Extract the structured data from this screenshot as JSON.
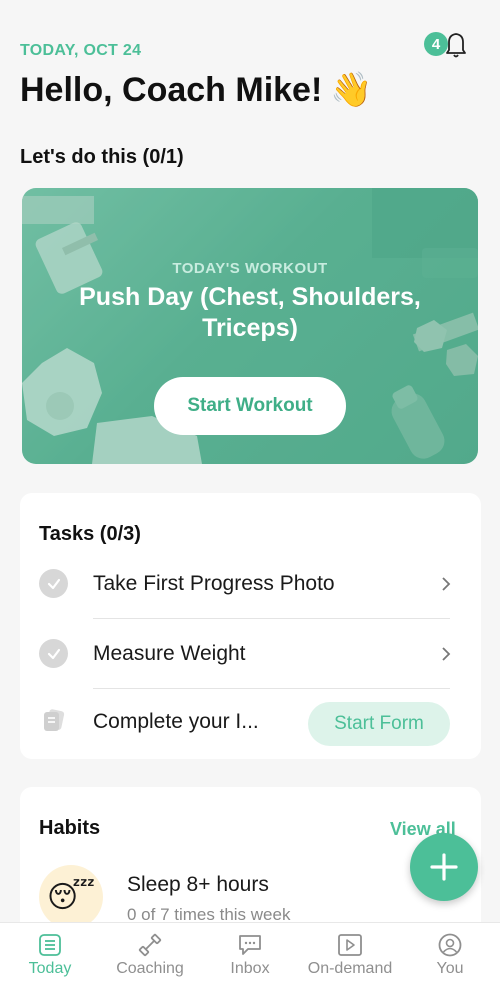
{
  "header": {
    "date": "TODAY, OCT 24",
    "greeting": "Hello, Coach Mike!",
    "greeting_emoji": "👋",
    "notification_count": "4",
    "accent_color": "#4cbf98"
  },
  "workout": {
    "section_title": "Let's do this (0/1)",
    "subtitle": "TODAY'S WORKOUT",
    "title": "Push Day (Chest, Shoulders, Triceps)",
    "button_label": "Start Workout"
  },
  "tasks": {
    "title": "Tasks (0/3)",
    "items": [
      {
        "label": "Take First Progress Photo",
        "icon": "check-circle-icon"
      },
      {
        "label": "Measure Weight",
        "icon": "check-circle-icon"
      },
      {
        "label": "Complete your I...",
        "icon": "form-icon",
        "action": "Start Form"
      }
    ]
  },
  "habits": {
    "title": "Habits",
    "view_all": "View all",
    "items": [
      {
        "name": "Sleep 8+ hours",
        "progress": "0 of 7 times this week",
        "emoji": "😴"
      }
    ]
  },
  "tabbar": {
    "tabs": [
      {
        "label": "Today",
        "icon": "list-icon",
        "active": true
      },
      {
        "label": "Coaching",
        "icon": "dumbbell-icon",
        "active": false
      },
      {
        "label": "Inbox",
        "icon": "chat-icon",
        "active": false
      },
      {
        "label": "On-demand",
        "icon": "play-icon",
        "active": false
      },
      {
        "label": "You",
        "icon": "user-icon",
        "active": false
      }
    ]
  }
}
